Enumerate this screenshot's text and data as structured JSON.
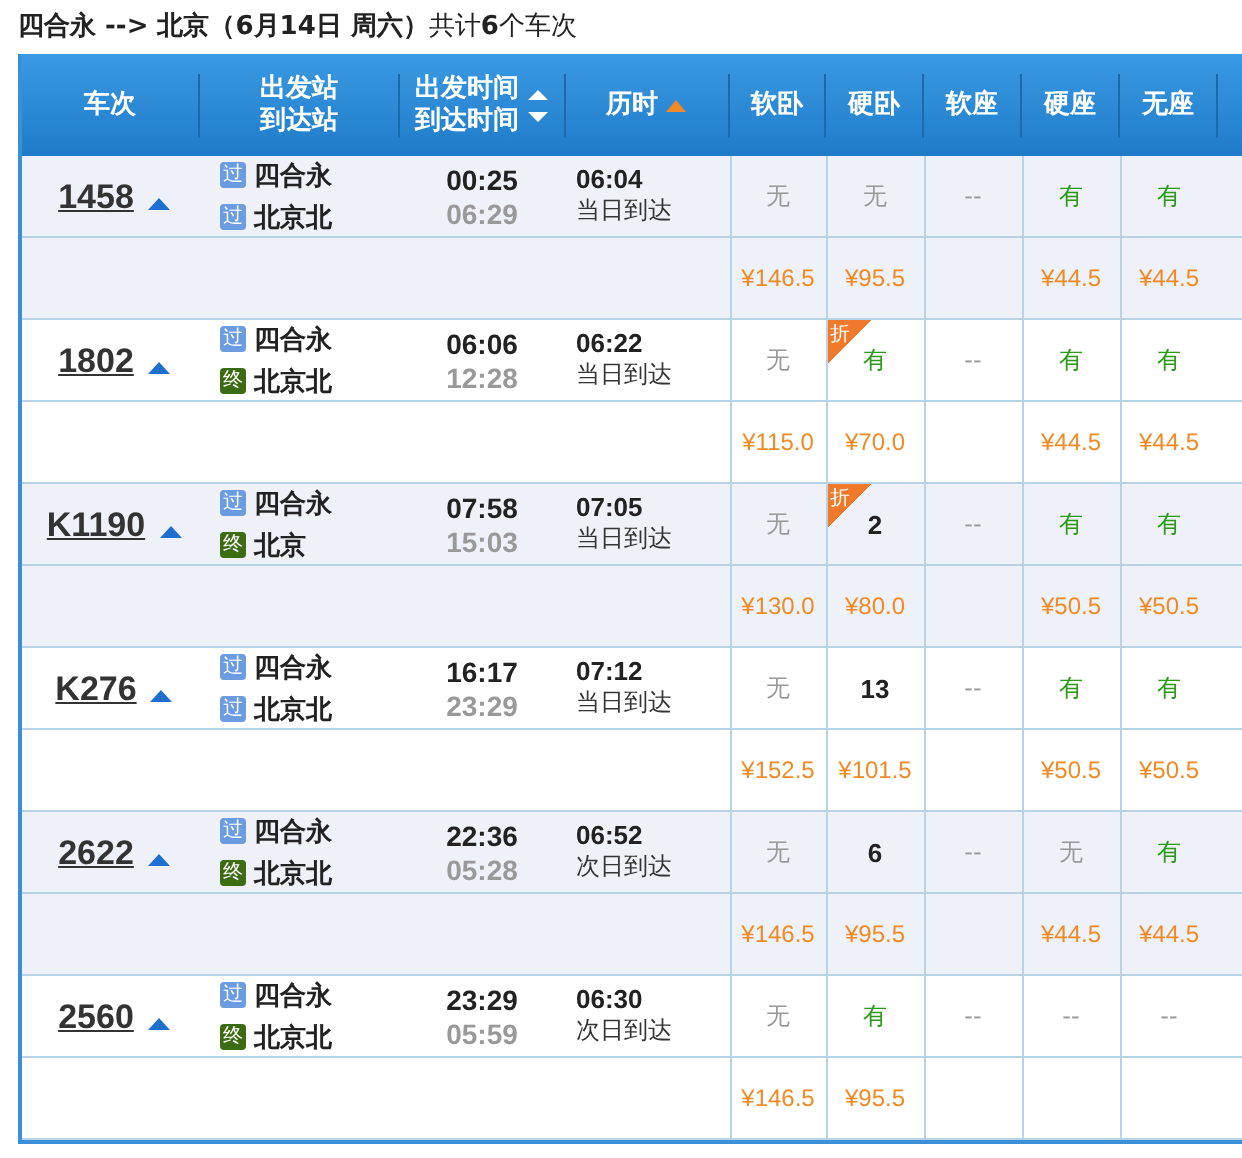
{
  "title": "**四合永 --> 北京（6月14日  周六）**共计**6**个车次",
  "columns": [
    {
      "lines": [
        "车次"
      ],
      "kind": "plain"
    },
    {
      "lines": [
        "出发站",
        "到达站"
      ],
      "kind": "plain"
    },
    {
      "lines": [
        "出发时间",
        "到达时间"
      ],
      "kind": "sortboth"
    },
    {
      "lines": [
        "历时"
      ],
      "kind": "sortup"
    },
    {
      "lines": [
        "软卧"
      ],
      "kind": "plain"
    },
    {
      "lines": [
        "硬卧"
      ],
      "kind": "plain"
    },
    {
      "lines": [
        "软座"
      ],
      "kind": "plain"
    },
    {
      "lines": [
        "硬座"
      ],
      "kind": "plain"
    },
    {
      "lines": [
        "无座"
      ],
      "kind": "plain"
    }
  ],
  "trains": [
    {
      "number": "1458",
      "from": {
        "badge": "过",
        "kind": "pass",
        "name": "四合永"
      },
      "to": {
        "badge": "过",
        "kind": "pass",
        "name": "北京北"
      },
      "depart": "00:25",
      "arrive": "06:29",
      "duration": "06:04",
      "arrival_day": "当日到达",
      "seats": [
        {
          "kind": "none",
          "status": "无",
          "price": "¥146.5"
        },
        {
          "kind": "none",
          "status": "无",
          "price": "¥95.5"
        },
        {
          "kind": "dash",
          "status": "--"
        },
        {
          "kind": "available",
          "status": "有",
          "price": "¥44.5"
        },
        {
          "kind": "available",
          "status": "有",
          "price": "¥44.5"
        }
      ]
    },
    {
      "number": "1802",
      "from": {
        "badge": "过",
        "kind": "pass",
        "name": "四合永"
      },
      "to": {
        "badge": "终",
        "kind": "terminal",
        "name": "北京北"
      },
      "depart": "06:06",
      "arrive": "12:28",
      "duration": "06:22",
      "arrival_day": "当日到达",
      "seats": [
        {
          "kind": "none",
          "status": "无",
          "price": "¥115.0"
        },
        {
          "kind": "available",
          "status": "有",
          "price": "¥70.0",
          "discount": "折"
        },
        {
          "kind": "dash",
          "status": "--"
        },
        {
          "kind": "available",
          "status": "有",
          "price": "¥44.5"
        },
        {
          "kind": "available",
          "status": "有",
          "price": "¥44.5"
        }
      ]
    },
    {
      "number": "K1190",
      "from": {
        "badge": "过",
        "kind": "pass",
        "name": "四合永"
      },
      "to": {
        "badge": "终",
        "kind": "terminal",
        "name": "北京"
      },
      "depart": "07:58",
      "arrive": "15:03",
      "duration": "07:05",
      "arrival_day": "当日到达",
      "seats": [
        {
          "kind": "none",
          "status": "无",
          "price": "¥130.0"
        },
        {
          "kind": "count",
          "status": "2",
          "price": "¥80.0",
          "discount": "折"
        },
        {
          "kind": "dash",
          "status": "--"
        },
        {
          "kind": "available",
          "status": "有",
          "price": "¥50.5"
        },
        {
          "kind": "available",
          "status": "有",
          "price": "¥50.5"
        }
      ]
    },
    {
      "number": "K276",
      "from": {
        "badge": "过",
        "kind": "pass",
        "name": "四合永"
      },
      "to": {
        "badge": "过",
        "kind": "pass",
        "name": "北京北"
      },
      "depart": "16:17",
      "arrive": "23:29",
      "duration": "07:12",
      "arrival_day": "当日到达",
      "seats": [
        {
          "kind": "none",
          "status": "无",
          "price": "¥152.5"
        },
        {
          "kind": "count",
          "status": "13",
          "price": "¥101.5"
        },
        {
          "kind": "dash",
          "status": "--"
        },
        {
          "kind": "available",
          "status": "有",
          "price": "¥50.5"
        },
        {
          "kind": "available",
          "status": "有",
          "price": "¥50.5"
        }
      ]
    },
    {
      "number": "2622",
      "from": {
        "badge": "过",
        "kind": "pass",
        "name": "四合永"
      },
      "to": {
        "badge": "终",
        "kind": "terminal",
        "name": "北京北"
      },
      "depart": "22:36",
      "arrive": "05:28",
      "duration": "06:52",
      "arrival_day": "次日到达",
      "seats": [
        {
          "kind": "none",
          "status": "无",
          "price": "¥146.5"
        },
        {
          "kind": "count",
          "status": "6",
          "price": "¥95.5"
        },
        {
          "kind": "dash",
          "status": "--"
        },
        {
          "kind": "none",
          "status": "无",
          "price": "¥44.5"
        },
        {
          "kind": "available",
          "status": "有",
          "price": "¥44.5"
        }
      ]
    },
    {
      "number": "2560",
      "from": {
        "badge": "过",
        "kind": "pass",
        "name": "四合永"
      },
      "to": {
        "badge": "终",
        "kind": "terminal",
        "name": "北京北"
      },
      "depart": "23:29",
      "arrive": "05:59",
      "duration": "06:30",
      "arrival_day": "次日到达",
      "seats": [
        {
          "kind": "none",
          "status": "无",
          "price": "¥146.5"
        },
        {
          "kind": "available",
          "status": "有",
          "price": "¥95.5"
        },
        {
          "kind": "dash",
          "status": "--"
        },
        {
          "kind": "dash",
          "status": "--"
        },
        {
          "kind": "dash",
          "status": "--"
        }
      ]
    }
  ]
}
